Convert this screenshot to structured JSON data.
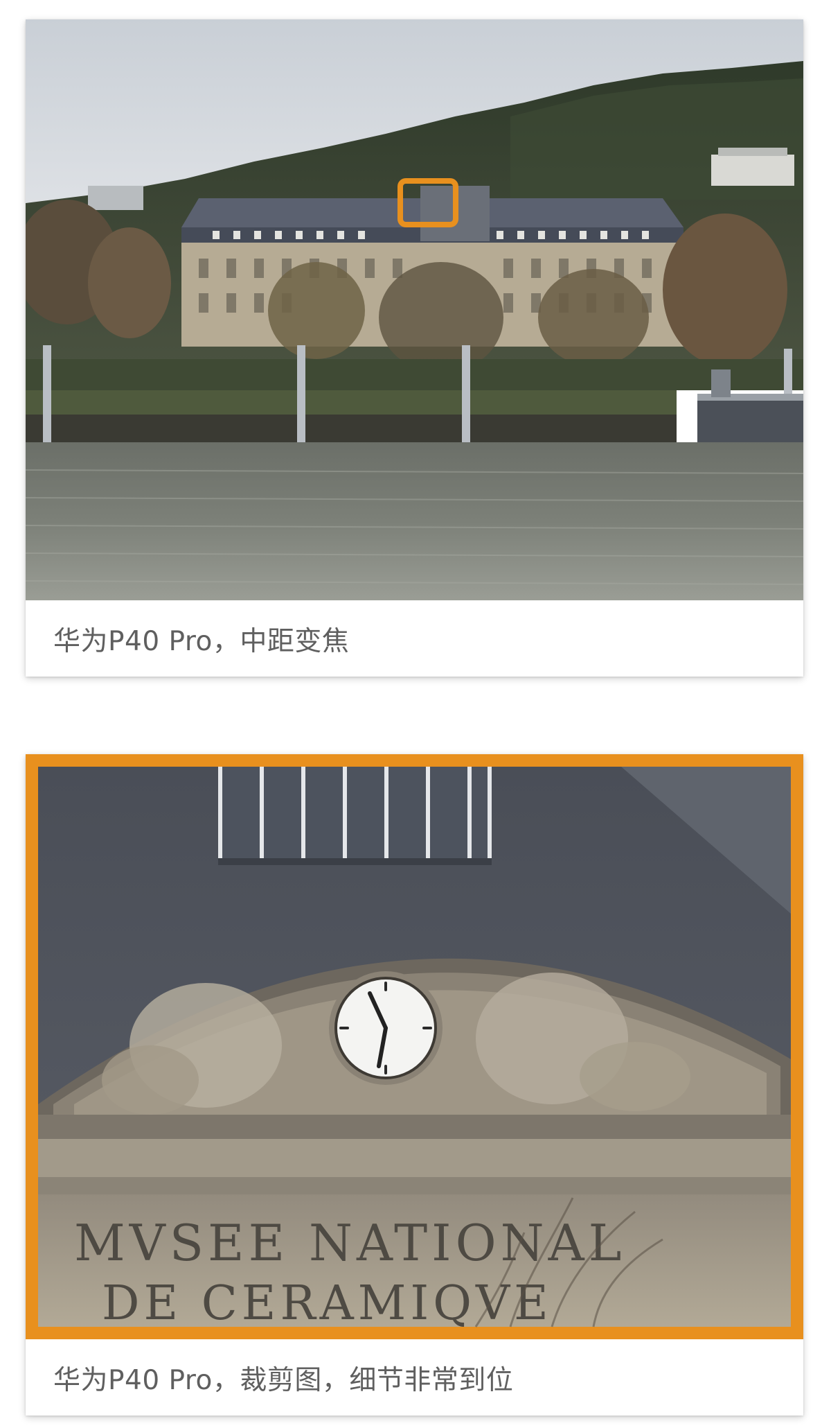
{
  "photos": [
    {
      "subject": "riverside building with a highlighted clock area",
      "caption": "华为P40 Pro，中距变焦"
    },
    {
      "subject": "cropped detail of the clock pediment",
      "caption": "华为P40 Pro，裁剪图，细节非常到位",
      "inscription": {
        "line1": "MVSEE NATIONAL",
        "line2": "DE CERAMIQVE"
      }
    }
  ],
  "colors": {
    "highlight": "#e8901e",
    "caption_text": "#5f5f5f"
  }
}
